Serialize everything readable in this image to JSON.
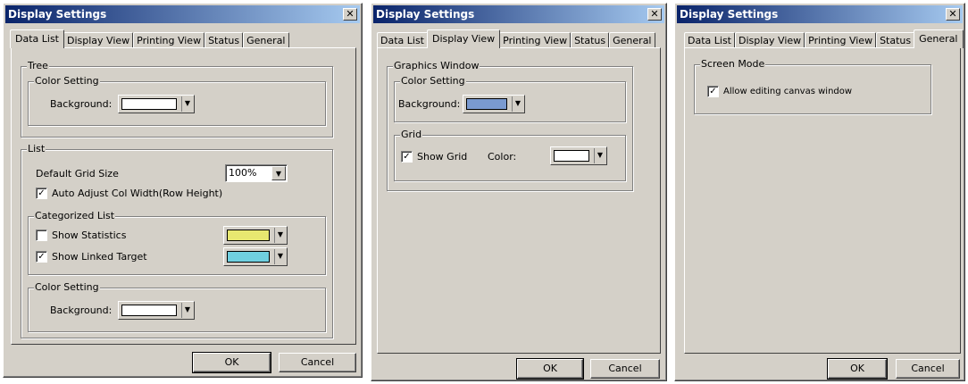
{
  "dialogs": [
    {
      "title": "Display Settings",
      "tabs": [
        "Data List",
        "Display View",
        "Printing View",
        "Status",
        "General"
      ],
      "active_tab": "Data List",
      "tree_group": "Tree",
      "color_setting_group": "Color Setting",
      "background_label": "Background:",
      "background_color": "#ffffff",
      "list_group": "List",
      "default_grid_size_label": "Default Grid Size",
      "default_grid_size_value": "100%",
      "auto_adjust_label": "Auto Adjust Col Width(Row Height)",
      "auto_adjust_checked": true,
      "categorized_group": "Categorized List",
      "show_statistics_label": "Show Statistics",
      "show_statistics_checked": false,
      "statistics_color": "#e8e870",
      "show_linked_label": "Show Linked Target",
      "show_linked_checked": true,
      "linked_color": "#70d0e0",
      "list_color_group": "Color Setting",
      "list_background_label": "Background:",
      "list_background_color": "#ffffff",
      "ok": "OK",
      "cancel": "Cancel"
    },
    {
      "title": "Display Settings",
      "tabs": [
        "Data List",
        "Display View",
        "Printing View",
        "Status",
        "General"
      ],
      "active_tab": "Display View",
      "graphics_group": "Graphics Window",
      "color_setting_group": "Color Setting",
      "background_label": "Background:",
      "background_color": "#7a9ad0",
      "grid_group": "Grid",
      "show_grid_label": "Show Grid",
      "show_grid_checked": true,
      "color_label": "Color:",
      "grid_color": "#ffffff",
      "ok": "OK",
      "cancel": "Cancel"
    },
    {
      "title": "Display Settings",
      "tabs": [
        "Data List",
        "Display View",
        "Printing View",
        "Status",
        "General"
      ],
      "active_tab": "General",
      "screen_mode_group": "Screen Mode",
      "allow_editing_label": "Allow editing canvas window",
      "allow_editing_checked": true,
      "ok": "OK",
      "cancel": "Cancel"
    }
  ],
  "icons": {
    "close": "close-icon",
    "check": "check-icon",
    "dropdown": "dropdown-arrow-icon"
  }
}
